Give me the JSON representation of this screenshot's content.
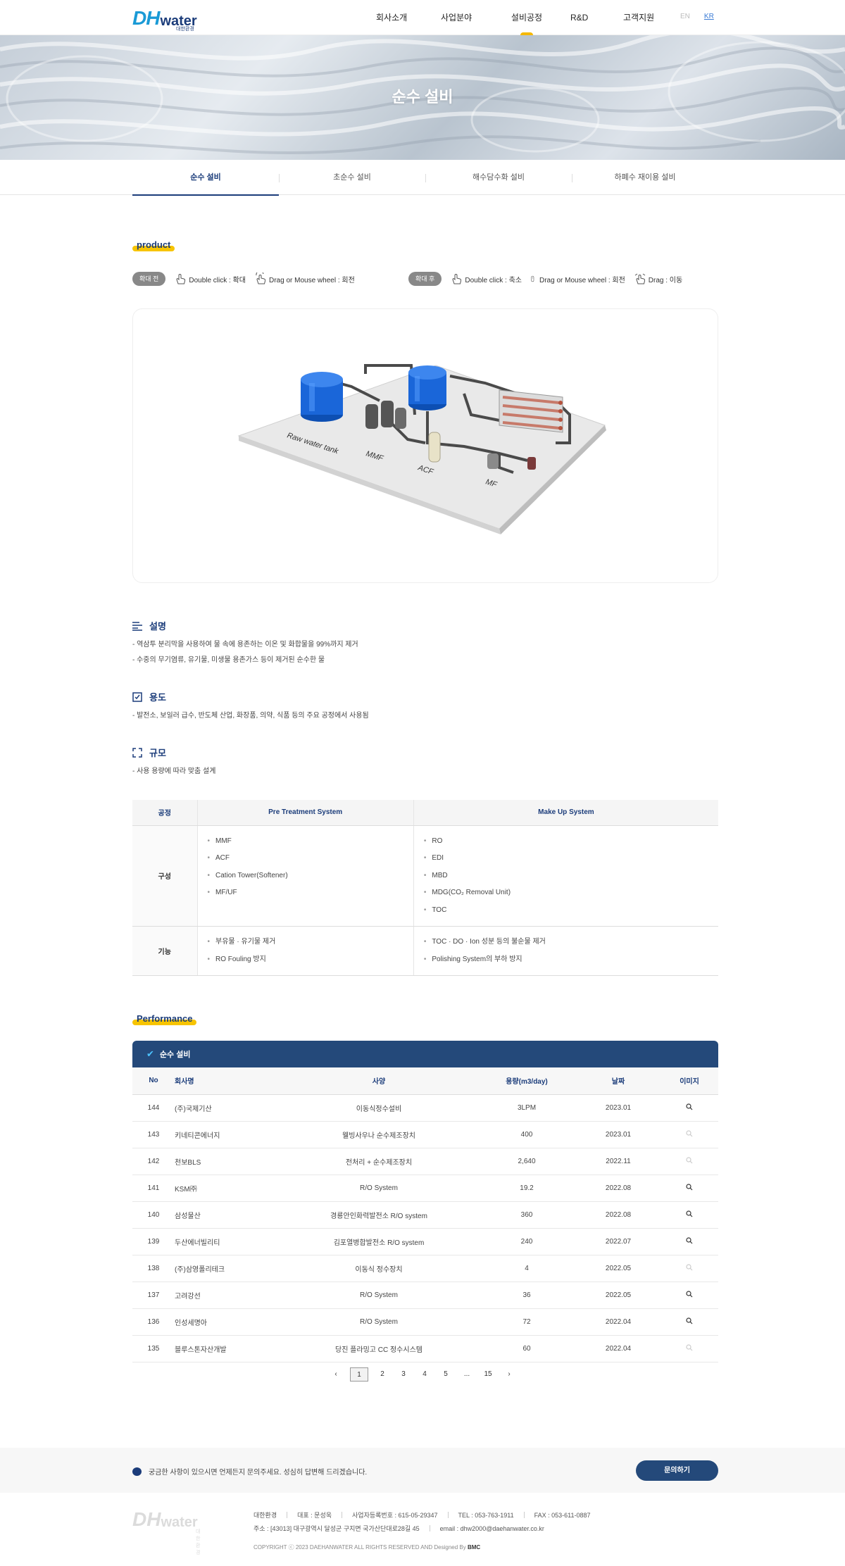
{
  "header": {
    "logo_dh": "DH",
    "logo_water": "water",
    "logo_sub": "대한환경",
    "nav": [
      "회사소개",
      "사업분야",
      "설비공정",
      "R&D",
      "고객지원"
    ],
    "active_nav": "설비공정",
    "lang": [
      "EN",
      "KR"
    ],
    "active_lang": "KR"
  },
  "hero": {
    "title": "순수 설비"
  },
  "subnav": [
    "순수 설비",
    "초순수 설비",
    "해수담수화 설비",
    "하폐수 재이용 설비"
  ],
  "product": {
    "title": "product",
    "before": {
      "pill": "확대 전",
      "items": [
        "Double click : 확대",
        "Drag or Mouse wheel : 회전"
      ]
    },
    "after": {
      "pill": "확대 후",
      "items": [
        "Double click : 축소",
        "Drag or Mouse wheel : 회전",
        "Drag : 이동"
      ]
    },
    "labels": [
      "Raw water tank",
      "MMF",
      "ACF",
      "MF"
    ]
  },
  "description": {
    "title": "설명",
    "lines": [
      "-  역삼투 분리막을 사용하여 물 속에 용존하는 이온 및 화합물을 99%까지 제거",
      "-  수중의 무기염류, 유기물, 미생물 용존가스 등이 제거된 순수한 물"
    ]
  },
  "usage": {
    "title": "용도",
    "lines": [
      "-  발전소, 보일러 급수, 반도체 산업, 화장품, 의약, 식품 등의 주요 공정에서 사용됨"
    ]
  },
  "scale": {
    "title": "규모",
    "lines": [
      "-  사용 용량에 따라 맞춤 설계"
    ]
  },
  "spec": {
    "headers": [
      "공정",
      "Pre Treatment System",
      "Make Up System"
    ],
    "rows": [
      {
        "label": "구성",
        "pre": [
          "MMF",
          "ACF",
          "Cation Tower(Softener)",
          "MF/UF"
        ],
        "make": [
          "RO",
          "EDI",
          "MBD",
          "MDG(CO₂ Removal Unit)",
          "TOC"
        ]
      },
      {
        "label": "기능",
        "pre": [
          "부유물 · 유기물 제거",
          "RO Fouling 방지"
        ],
        "make": [
          "TOC · DO · Ion 성분 등의 불순물 제거",
          "Polishing System의 부하 방지"
        ]
      }
    ]
  },
  "performance": {
    "title": "Performance",
    "bar": "순수 설비",
    "headers": [
      "No",
      "회사명",
      "사양",
      "용량(m3/day)",
      "날짜",
      "이미지"
    ],
    "rows": [
      {
        "no": "144",
        "company": "(주)국제기산",
        "spec": "이동식정수설비",
        "cap": "3LPM",
        "date": "2023.01",
        "img": true
      },
      {
        "no": "143",
        "company": "키네티콘에너지",
        "spec": "웰빙사우나 순수제조장치",
        "cap": "400",
        "date": "2023.01",
        "img": false
      },
      {
        "no": "142",
        "company": "천보BLS",
        "spec": "전처리 + 순수제조장치",
        "cap": "2,640",
        "date": "2022.11",
        "img": false
      },
      {
        "no": "141",
        "company": "KSM㈜",
        "spec": "R/O System",
        "cap": "19.2",
        "date": "2022.08",
        "img": true
      },
      {
        "no": "140",
        "company": "삼성물산",
        "spec": "경룡안인화력발전소 R/O system",
        "cap": "360",
        "date": "2022.08",
        "img": true
      },
      {
        "no": "139",
        "company": "두산에너빌리티",
        "spec": "김포열병합발전소 R/O system",
        "cap": "240",
        "date": "2022.07",
        "img": true
      },
      {
        "no": "138",
        "company": "(주)삼영폴리테크",
        "spec": "이동식 정수장치",
        "cap": "4",
        "date": "2022.05",
        "img": false
      },
      {
        "no": "137",
        "company": "고려강선",
        "spec": "R/O System",
        "cap": "36",
        "date": "2022.05",
        "img": true
      },
      {
        "no": "136",
        "company": "인성세명아",
        "spec": "R/O System",
        "cap": "72",
        "date": "2022.04",
        "img": true
      },
      {
        "no": "135",
        "company": "블루스톤자산개발",
        "spec": "당진 플라밍고 CC 정수시스템",
        "cap": "60",
        "date": "2022.04",
        "img": false
      }
    ],
    "pager": [
      "‹",
      "1",
      "2",
      "3",
      "4",
      "5",
      "...",
      "15",
      "›"
    ],
    "current_page": "1"
  },
  "qna": {
    "text": "궁금한 사항이 있으시면 언제든지 문의주세요. 성심히 답변해 드리겠습니다.",
    "button": "문의하기"
  },
  "footer": {
    "row1": [
      "대한환경",
      "대표 : 문성욱",
      "사업자등록번호 : 615-05-29347",
      "TEL : 053-763-1911",
      "FAX : 053-611-0887"
    ],
    "row2": [
      "주소 : [43013] 대구광역시 달성군 구지면 국가산단대로28길 45",
      "email : dhw2000@daehanwater.co.kr"
    ],
    "copyright": "COPYRIGHT ⓒ 2023 DAEHANWATER ALL RIGHTS RESERVED AND Designed By",
    "designer": "BMC"
  }
}
